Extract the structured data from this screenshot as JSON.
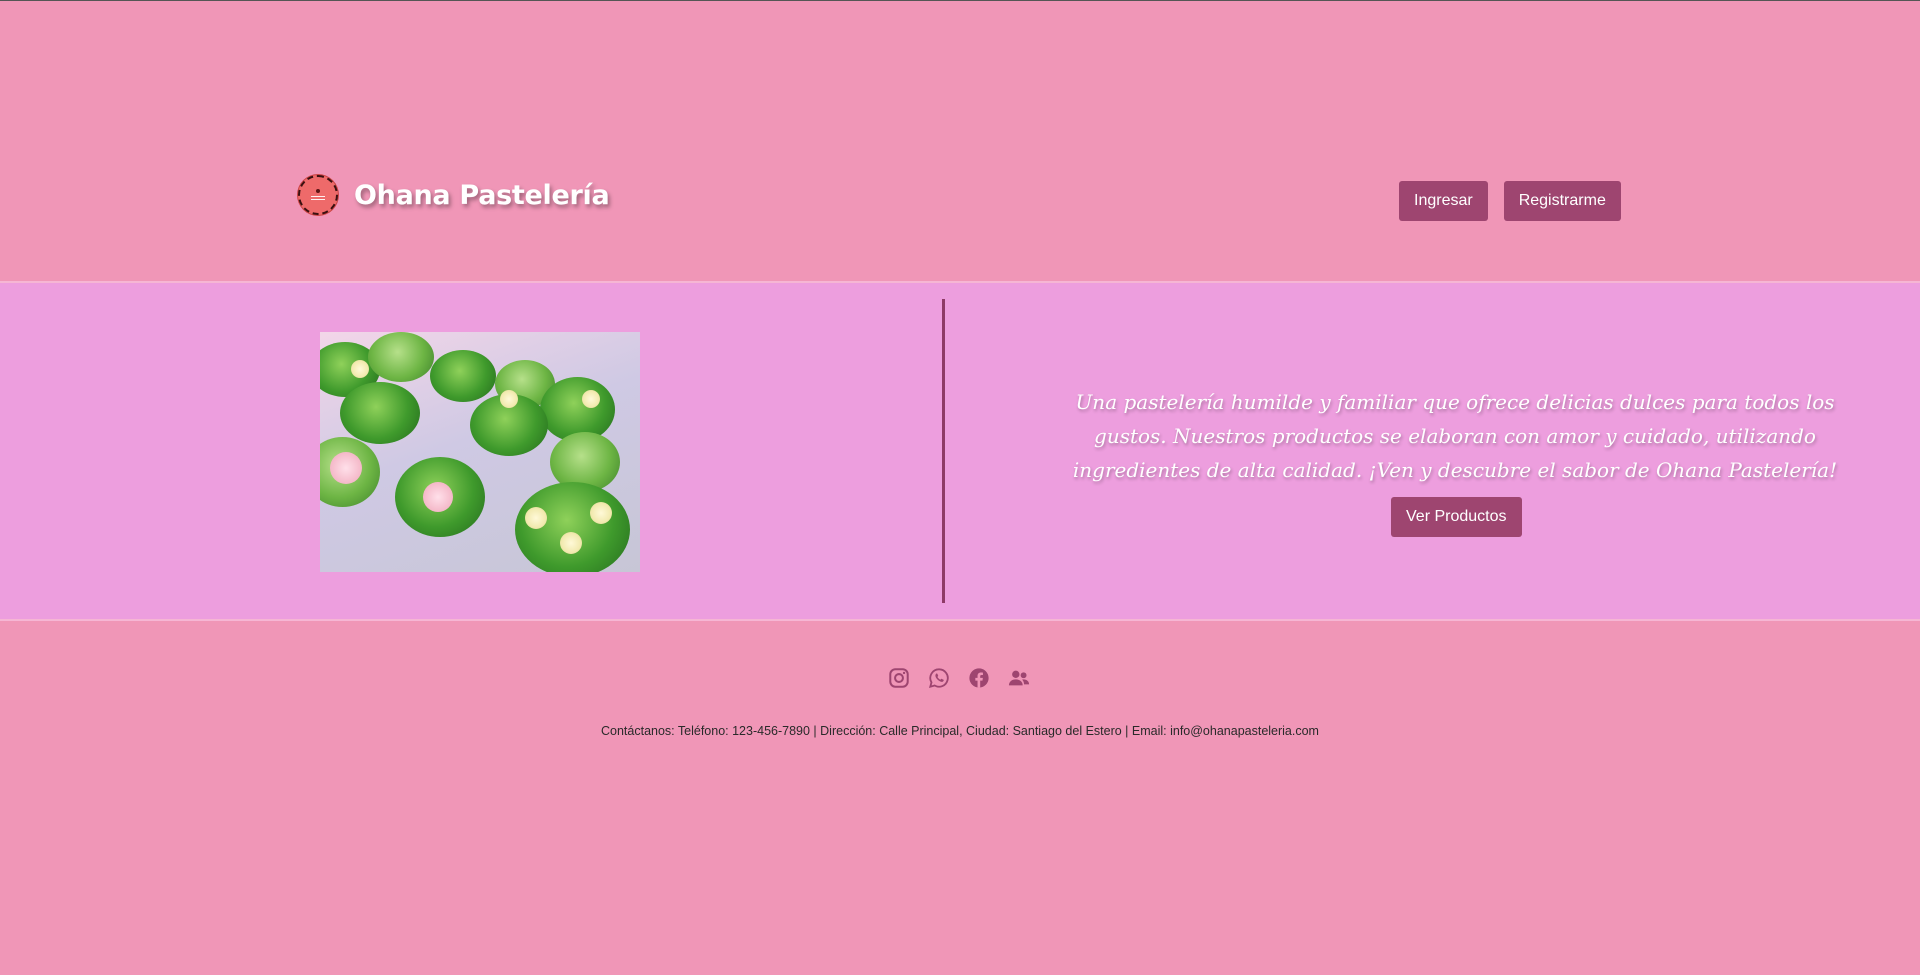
{
  "brand": {
    "name": "Ohana Pastelería",
    "logo_icon": "cake-logo-icon"
  },
  "auth": {
    "login_label": "Ingresar",
    "register_label": "Registrarme"
  },
  "hero": {
    "image_alt": "cupcakes-image",
    "description": "Una pastelería humilde y familiar que ofrece delicias dulces para todos los gustos. Nuestros productos se elaboran con amor y cuidado, utilizando ingredientes de alta calidad. ¡Ven y descubre el sabor de Ohana Pastelería!",
    "cta_label": "Ver Productos"
  },
  "footer": {
    "social_icons": [
      "instagram-icon",
      "whatsapp-icon",
      "facebook-icon",
      "users-icon"
    ],
    "contact": "Contáctanos: Teléfono: 123-456-7890 | Dirección: Calle Principal, Ciudad: Santiago del Estero | Email: info@ohanapasteleria.com"
  },
  "colors": {
    "background": "#f096b7",
    "hero_background": "#ed9ede",
    "button": "#9e4570",
    "icon": "#9e4570"
  }
}
